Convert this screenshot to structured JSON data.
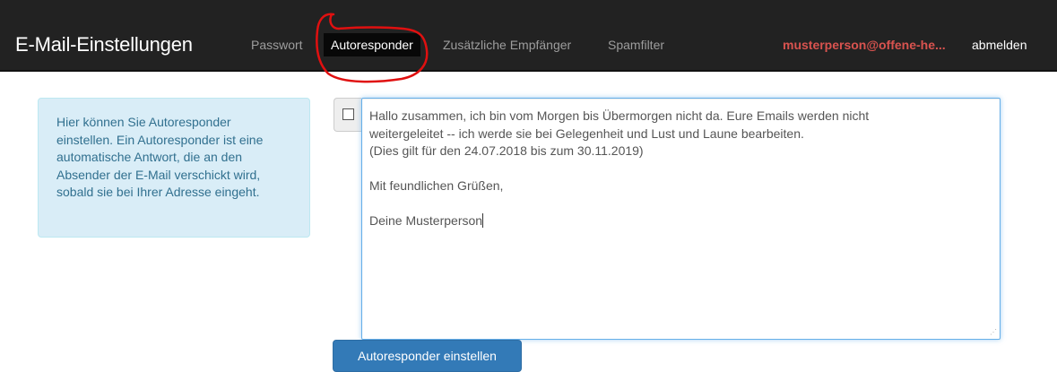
{
  "navbar": {
    "brand": "E-Mail-Einstellungen",
    "items": [
      {
        "label": "Passwort"
      },
      {
        "label": "Autoresponder",
        "active": true
      },
      {
        "label": "Zusätzliche Empfänger"
      },
      {
        "label": "Spamfilter"
      }
    ],
    "user_email": "musterperson@offene-he...",
    "logout_label": "abmelden"
  },
  "info": {
    "lines": [
      "Hier können Sie Autoresponder",
      "einstellen. Ein Autoresponder ist eine",
      "automatische Antwort, die an den",
      "Absender der E-Mail verschickt wird,",
      "sobald sie bei Ihrer Adresse eingeht."
    ]
  },
  "autoresponder": {
    "enabled": false,
    "message_lines": [
      "Hallo zusammen, ich bin vom Morgen bis Übermorgen nicht da. Eure Emails werden nicht",
      "weitergeleitet -- ich werde sie bei Gelegenheit und Lust und Laune bearbeiten.",
      "(Dies gilt für den 24.07.2018 bis zum 30.11.2019)",
      "",
      "Mit feundlichen Grüßen,",
      "",
      "Deine Musterperson"
    ],
    "submit_label": "Autoresponder einstellen"
  },
  "colors": {
    "navbar_bg": "#222222",
    "email_color": "#d9534f",
    "info_bg": "#d9edf7",
    "info_text": "#31708f",
    "button_bg": "#337ab7",
    "annotation": "#e01010"
  }
}
